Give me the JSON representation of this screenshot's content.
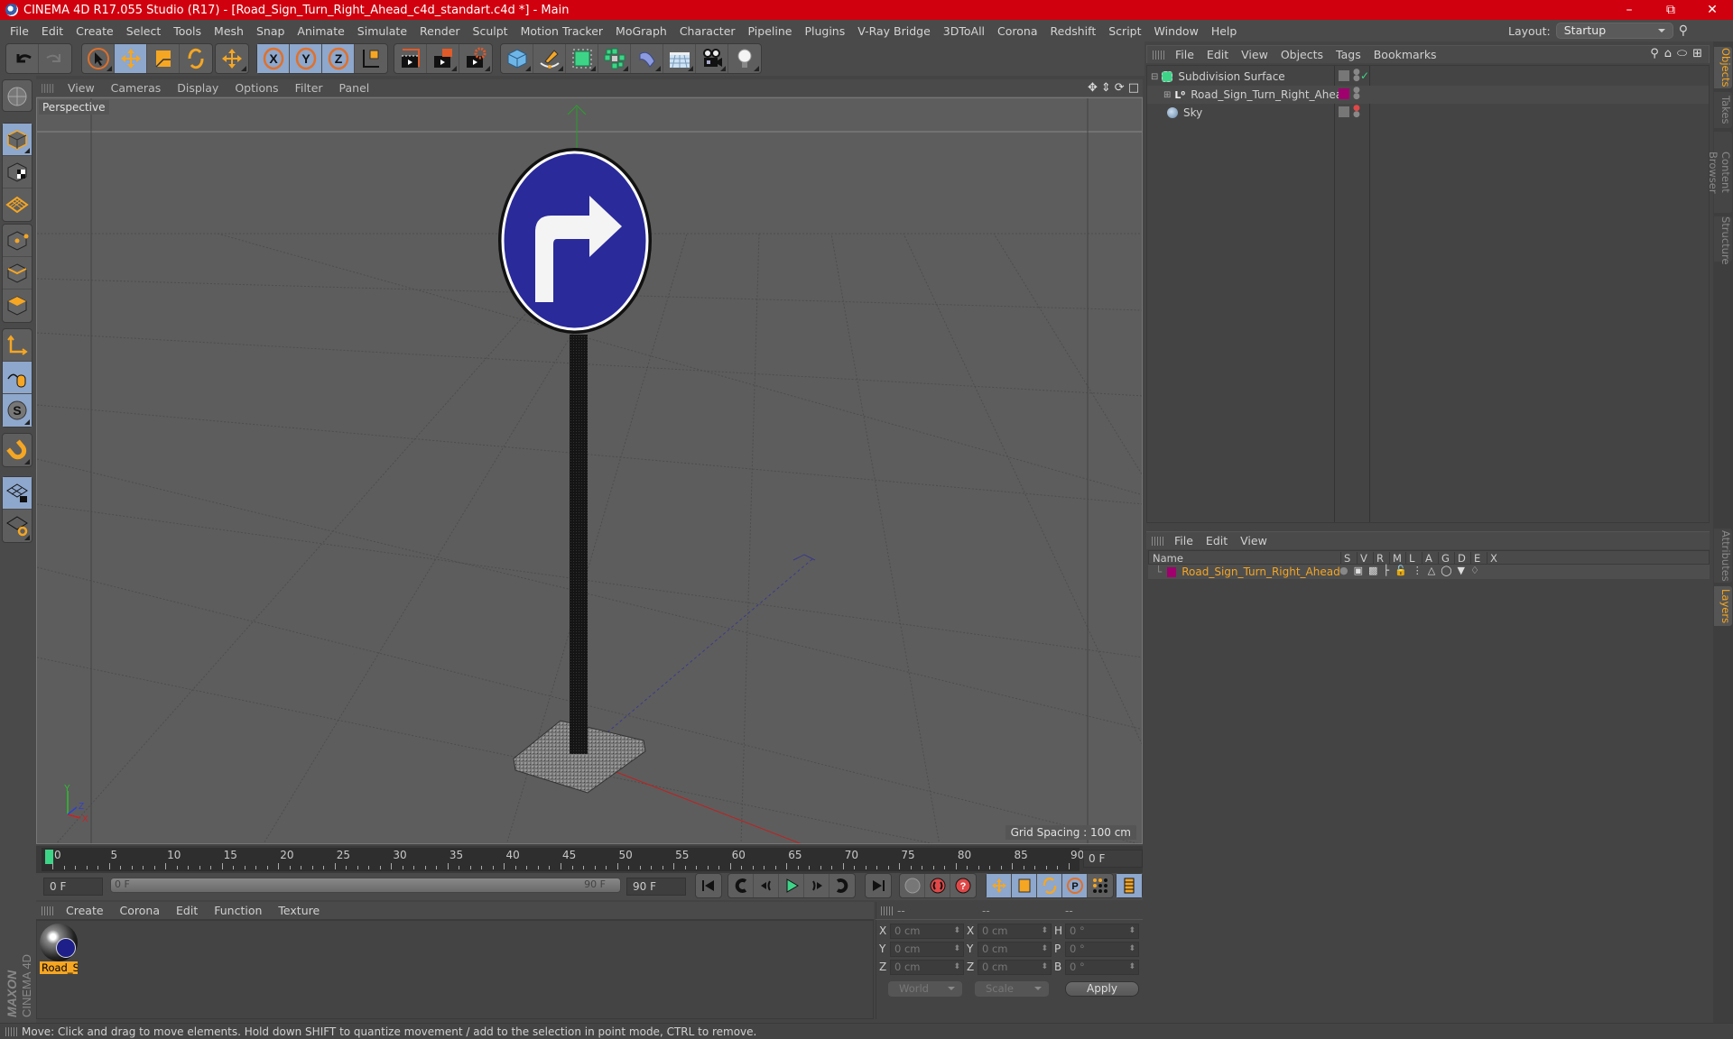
{
  "window": {
    "title": "CINEMA 4D R17.055 Studio (R17) - [Road_Sign_Turn_Right_Ahead_c4d_standart.c4d *] - Main",
    "controls": [
      "minimize-icon",
      "restore-icon",
      "close-icon"
    ]
  },
  "menubar": [
    "File",
    "Edit",
    "Create",
    "Select",
    "Tools",
    "Mesh",
    "Snap",
    "Animate",
    "Simulate",
    "Render",
    "Sculpt",
    "Motion Tracker",
    "MoGraph",
    "Character",
    "Pipeline",
    "Plugins",
    "V-Ray Bridge",
    "3DToAll",
    "Corona",
    "Redshift",
    "Script",
    "Window",
    "Help"
  ],
  "layout": {
    "label": "Layout:",
    "value": "Startup"
  },
  "toolbar": {
    "groups": [
      [
        "undo-icon",
        "redo-icon"
      ],
      [
        "select-icon",
        "move-icon",
        "scale-icon",
        "rotate-icon"
      ],
      [
        "recent-tool-icon"
      ],
      [
        "x-axis-icon",
        "y-axis-icon",
        "z-axis-icon",
        "world-coords-icon"
      ],
      [
        "render-view-icon",
        "render-picture-viewer-icon",
        "render-settings-icon"
      ],
      [
        "cube-icon",
        "pen-spline-icon",
        "subdivision-icon",
        "cloner-icon",
        "deformer-icon",
        "floor-icon",
        "camera-icon",
        "light-icon"
      ]
    ]
  },
  "left_tools": [
    "model-mode-icon",
    "texture-mode-icon",
    "workplane-mode-icon",
    "points-mode-icon",
    "edges-mode-icon",
    "polygons-mode-icon",
    "axis-icon",
    "tweak-icon",
    "snap-icon",
    "magnet-icon",
    "lock-workplane-icon",
    "workplane-rotate-icon"
  ],
  "viewport": {
    "menu": [
      "View",
      "Cameras",
      "Display",
      "Options",
      "Filter",
      "Panel"
    ],
    "label": "Perspective",
    "grid_spacing": "Grid Spacing : 100 cm",
    "axis_labels": {
      "x": "X",
      "y": "Y",
      "z": "Z"
    }
  },
  "timeline": {
    "ticks": [
      "0",
      "5",
      "10",
      "15",
      "20",
      "25",
      "30",
      "35",
      "40",
      "45",
      "50",
      "55",
      "60",
      "65",
      "70",
      "75",
      "80",
      "85",
      "90"
    ],
    "current_frame": "0 F",
    "start_field": "0 F",
    "range_start": "0 F",
    "range_end": "90 F",
    "end_field": "90 F"
  },
  "material_manager": {
    "menu": [
      "Create",
      "Corona",
      "Edit",
      "Function",
      "Texture"
    ],
    "materials": [
      {
        "name": "Road_Si"
      }
    ]
  },
  "brand": {
    "maxon": "MAXON",
    "product": "CINEMA 4D"
  },
  "coordinates": {
    "headers": [
      "--",
      "--",
      "--"
    ],
    "rows": [
      {
        "label1": "X",
        "pos": "0 cm",
        "label2": "X",
        "size": "0 cm",
        "label3": "H",
        "rot": "0 °"
      },
      {
        "label1": "Y",
        "pos": "0 cm",
        "label2": "Y",
        "size": "0 cm",
        "label3": "P",
        "rot": "0 °"
      },
      {
        "label1": "Z",
        "pos": "0 cm",
        "label2": "Z",
        "size": "0 cm",
        "label3": "B",
        "rot": "0 °"
      }
    ],
    "mode": "World",
    "size_mode": "Scale",
    "apply": "Apply"
  },
  "object_manager": {
    "menu": [
      "File",
      "Edit",
      "View",
      "Objects",
      "Tags",
      "Bookmarks"
    ],
    "objects": [
      {
        "name": "Subdivision Surface",
        "icon": "subdivision-icon"
      },
      {
        "name": "Road_Sign_Turn_Right_Ahead",
        "icon": "null-icon",
        "color": "#a0006e"
      },
      {
        "name": "Sky",
        "icon": "sky-icon"
      }
    ]
  },
  "layer_manager": {
    "menu": [
      "File",
      "Edit",
      "View"
    ],
    "columns": [
      "Name",
      "S",
      "V",
      "R",
      "M",
      "L",
      "A",
      "G",
      "D",
      "E",
      "X"
    ],
    "layers": [
      {
        "name": "Road_Sign_Turn_Right_Ahead",
        "color": "#a0006e"
      }
    ]
  },
  "side_tabs": {
    "top": [
      "Objects",
      "Takes",
      "Content Browser",
      "Structure"
    ],
    "bottom": [
      "Attributes",
      "Layers"
    ]
  },
  "status": "Move: Click and drag to move elements. Hold down SHIFT to quantize movement / add to the selection in point mode, CTRL to remove.",
  "colors": {
    "title_bar": "#d0000e",
    "accent_orange": "#f5a623",
    "selected_blue": "#8ea7cc",
    "sign_blue": "#2a2a9a"
  }
}
